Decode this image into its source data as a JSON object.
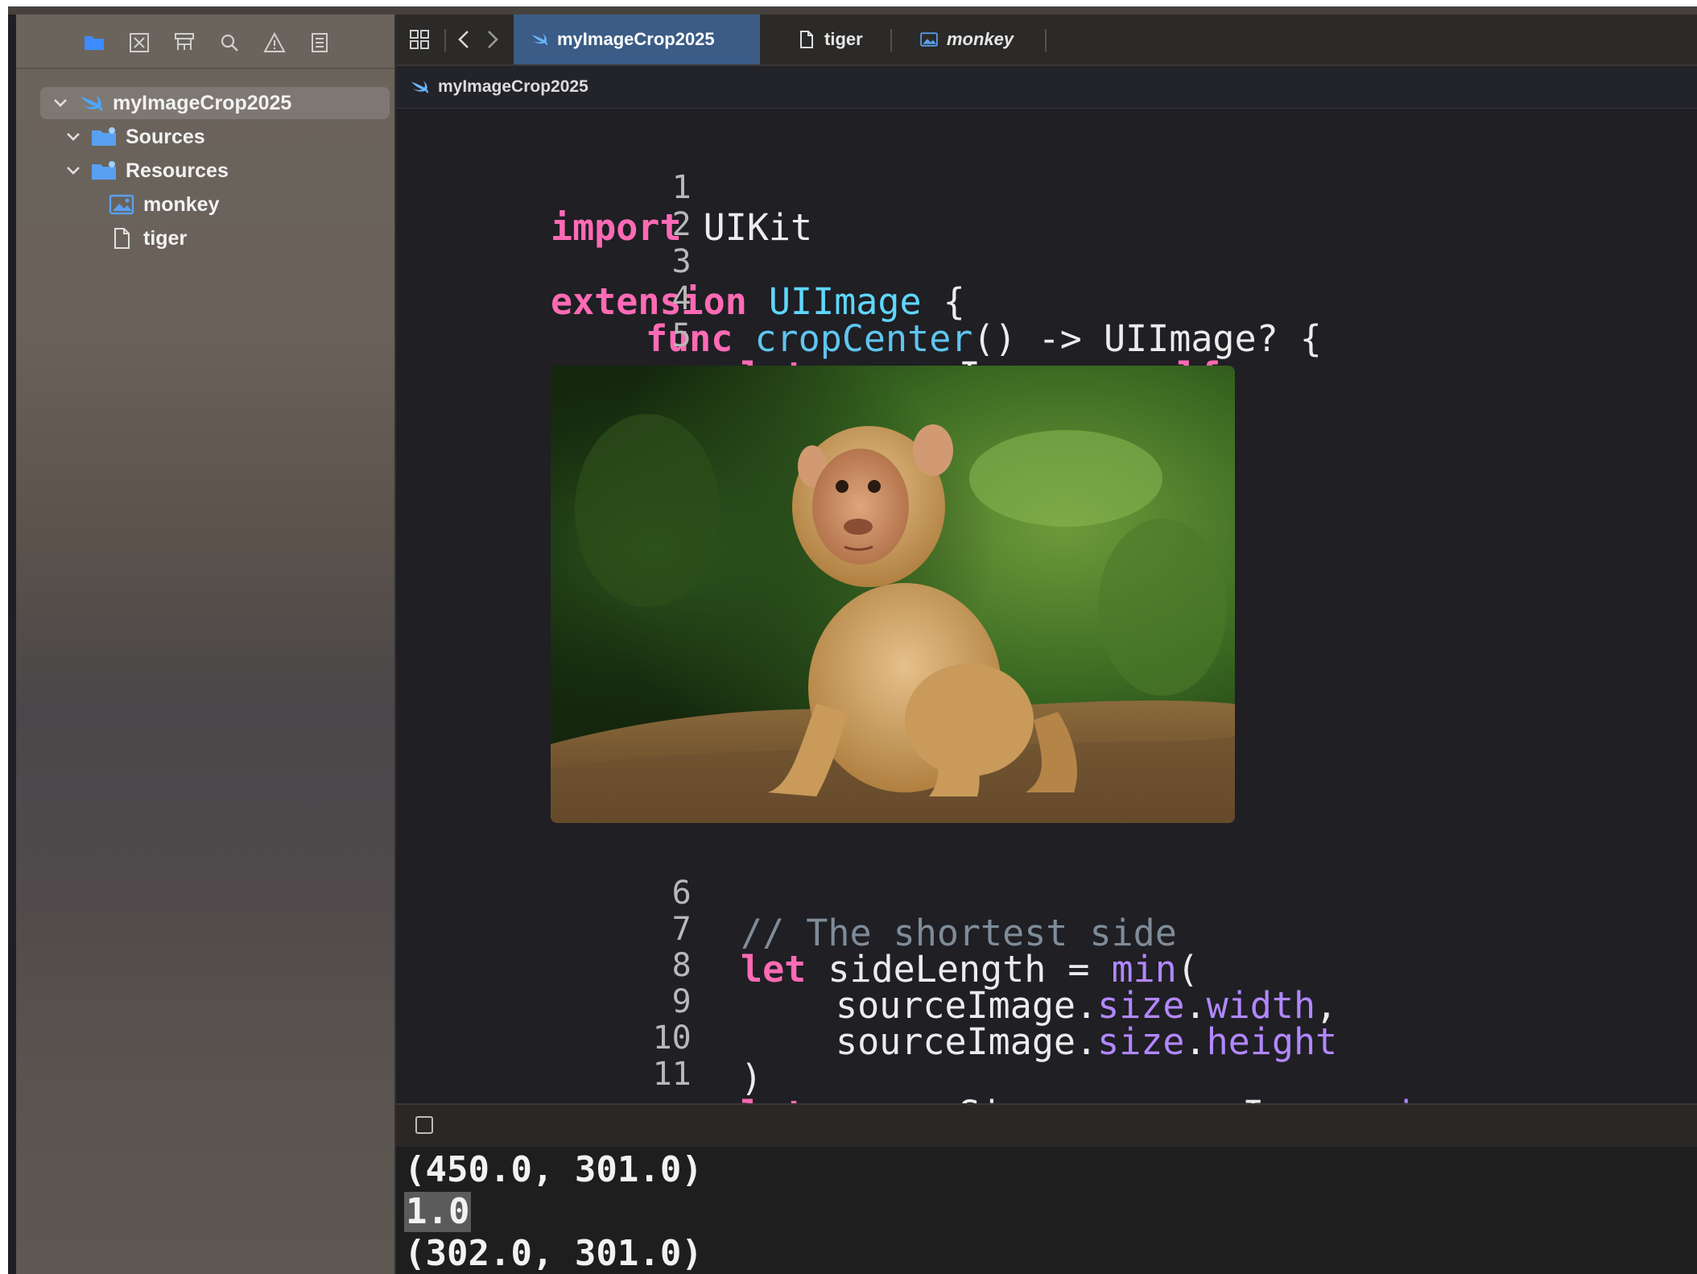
{
  "sidebar": {
    "toolbar_icons": [
      "folder-icon",
      "source-control-icon",
      "hierarchy-icon",
      "search-icon",
      "warning-icon",
      "report-icon"
    ],
    "tree": [
      {
        "label": "myImageCrop2025",
        "icon": "swift-icon",
        "expanded": true,
        "selected": true
      },
      {
        "label": "Sources",
        "icon": "folder-icon",
        "expanded": true
      },
      {
        "label": "Resources",
        "icon": "folder-icon",
        "expanded": true
      },
      {
        "label": "monkey",
        "icon": "image-file-icon"
      },
      {
        "label": "tiger",
        "icon": "document-icon"
      }
    ]
  },
  "tabs": [
    {
      "label": "myImageCrop2025",
      "icon": "swift-icon",
      "active": true
    },
    {
      "label": "tiger",
      "icon": "document-icon",
      "active": false
    },
    {
      "label": "monkey",
      "icon": "image-file-icon",
      "active": false
    }
  ],
  "jumpbar": {
    "label": "myImageCrop2025"
  },
  "code": {
    "lines": [
      {
        "n": "1"
      },
      {
        "n": "2"
      },
      {
        "n": "3"
      },
      {
        "n": "4"
      },
      {
        "n": "5"
      },
      {
        "n": "6"
      },
      {
        "n": "7"
      },
      {
        "n": "8"
      },
      {
        "n": "9"
      },
      {
        "n": "10"
      },
      {
        "n": "11"
      }
    ],
    "t": {
      "import": "import",
      "uikit": " UIKit",
      "extension": "extension",
      "uiimage": " UIImage",
      "brace": " {",
      "func": "func",
      "cropCenter": " cropCenter",
      "sig": "() -> UIImage? {",
      "let": "let",
      "sourceImage_eq": " sourceImage = ",
      "self": "self",
      "comment": "// The shortest side",
      "sideLength_eq": " sideLength = ",
      "min": "min",
      "paren_open": "(",
      "sourceImage_dot": "sourceImage.",
      "size": "size",
      "dot": ".",
      "width": "width",
      "comma": ",",
      "height": "height",
      "paren_close": ")",
      "sourceSize_eq": " sourceSize = sourceImage."
    },
    "preview_image": "monkey"
  },
  "console": {
    "output": [
      "(450.0, 301.0)",
      "1.0",
      "(302.0, 301.0)"
    ]
  },
  "colors": {
    "keyword": "#ff6ab4",
    "type": "#5fd7ff",
    "property": "#b287ff",
    "comment": "#7f8c98",
    "active_tab": "#3b5c86",
    "editor_bg": "#1f1f24"
  }
}
